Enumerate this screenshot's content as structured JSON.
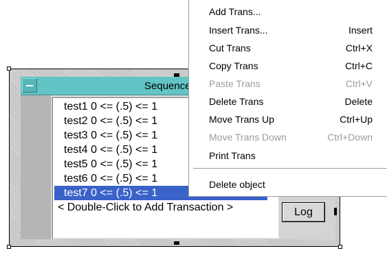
{
  "sequencer": {
    "title": "Sequencer",
    "transactions": [
      "test1 0 <= (.5) <= 1",
      "test2 0 <= (.5) <= 1",
      "test3 0 <= (.5) <= 1",
      "test4 0 <= (.5) <= 1",
      "test5 0 <= (.5) <= 1",
      "test6 0 <= (.5) <= 1",
      "test7 0 <= (.5) <= 1"
    ],
    "selected_index": 6,
    "add_hint": "< Double-Click to Add Transaction >",
    "log_button": "Log"
  },
  "context_menu": {
    "items": [
      {
        "label": "Add Trans...",
        "shortcut": "",
        "enabled": true
      },
      {
        "label": "Insert Trans...",
        "shortcut": "Insert",
        "enabled": true
      },
      {
        "label": "Cut Trans",
        "shortcut": "Ctrl+X",
        "enabled": true
      },
      {
        "label": "Copy Trans",
        "shortcut": "Ctrl+C",
        "enabled": true
      },
      {
        "label": "Paste Trans",
        "shortcut": "Ctrl+V",
        "enabled": false
      },
      {
        "label": "Delete Trans",
        "shortcut": "Delete",
        "enabled": true
      },
      {
        "label": "Move Trans Up",
        "shortcut": "Ctrl+Up",
        "enabled": true
      },
      {
        "label": "Move Trans Down",
        "shortcut": "Ctrl+Down",
        "enabled": false
      },
      {
        "label": "Print Trans",
        "shortcut": "",
        "enabled": true
      },
      {
        "label": "Delete object",
        "shortcut": "",
        "enabled": true
      }
    ]
  },
  "colors": {
    "titlebar": "#62c4c4",
    "selection": "#3a62c8",
    "disabled_text": "#9c9c9c"
  }
}
